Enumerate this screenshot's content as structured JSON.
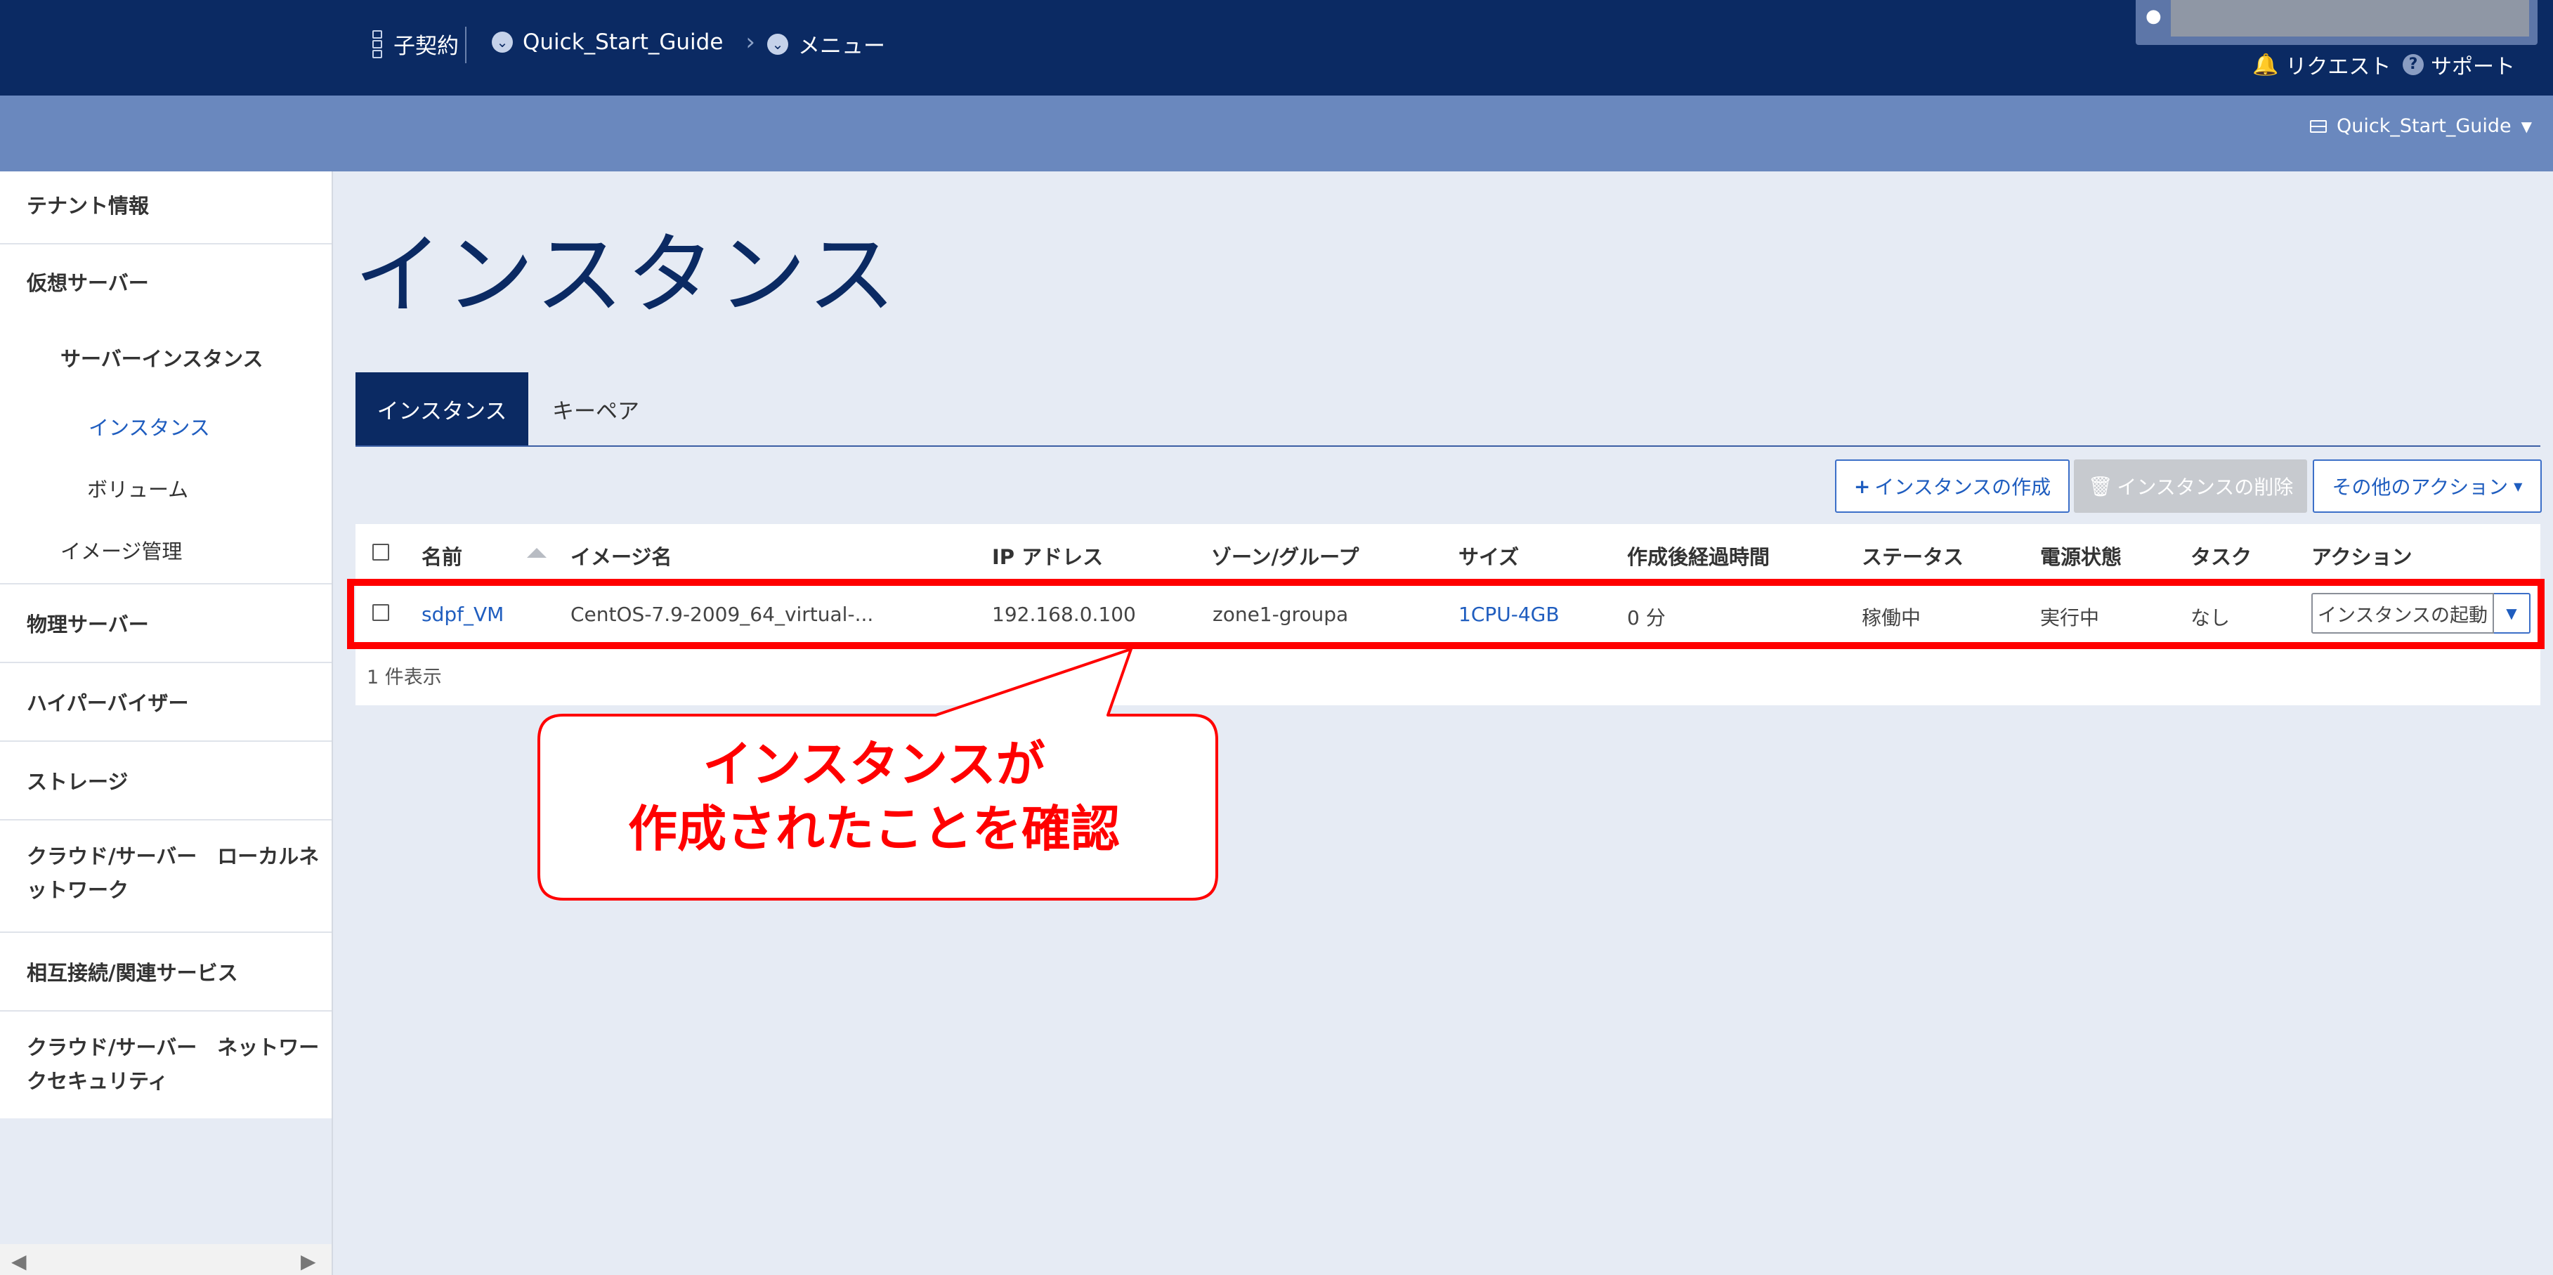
{
  "header": {
    "contract": "子契約",
    "project": "Quick_Start_Guide",
    "menu": "メニュー",
    "request": "リクエスト",
    "support": "サポート"
  },
  "subbar": {
    "project_select": "Quick_Start_Guide"
  },
  "sidebar": {
    "items": [
      {
        "label": "テナント情報"
      },
      {
        "label": "仮想サーバー"
      },
      {
        "label": "物理サーバー"
      },
      {
        "label": "ハイパーバイザー"
      },
      {
        "label": "ストレージ"
      },
      {
        "label": "クラウド/サーバー　ローカルネ"
      },
      {
        "label": "ットワーク"
      },
      {
        "label": "相互接続/関連サービス"
      },
      {
        "label": "クラウド/サーバー　ネットワー"
      },
      {
        "label": "クセキュリティ"
      }
    ],
    "sub": {
      "server_instance": "サーバーインスタンス",
      "instances": "インスタンス",
      "volumes": "ボリューム",
      "image_mgmt": "イメージ管理"
    }
  },
  "main": {
    "title": "インスタンス",
    "tabs": [
      {
        "label": "インスタンス"
      },
      {
        "label": "キーペア"
      }
    ],
    "buttons": {
      "create": "インスタンスの作成",
      "delete": "インスタンスの削除",
      "more": "その他のアクション"
    },
    "table": {
      "headers": [
        "名前",
        "イメージ名",
        "IP アドレス",
        "ゾーン/グループ",
        "サイズ",
        "作成後経過時間",
        "ステータス",
        "電源状態",
        "タスク",
        "アクション"
      ],
      "rows": [
        {
          "name": "sdpf_VM",
          "image": "CentOS-7.9-2009_64_virtual-...",
          "ip": "192.168.0.100",
          "zone": "zone1-groupa",
          "size": "1CPU-4GB",
          "age": "0 分",
          "status": "稼働中",
          "power": "実行中",
          "task": "なし",
          "action": "インスタンスの起動"
        }
      ],
      "count": "1 件表示"
    }
  },
  "annotation": {
    "line1": "インスタンスが",
    "line2": "作成されたことを確認",
    "color": "#ff0000"
  },
  "colors": {
    "navy": "#0b2a63",
    "subbar": "#6a88be",
    "link": "#1f5dbf"
  }
}
